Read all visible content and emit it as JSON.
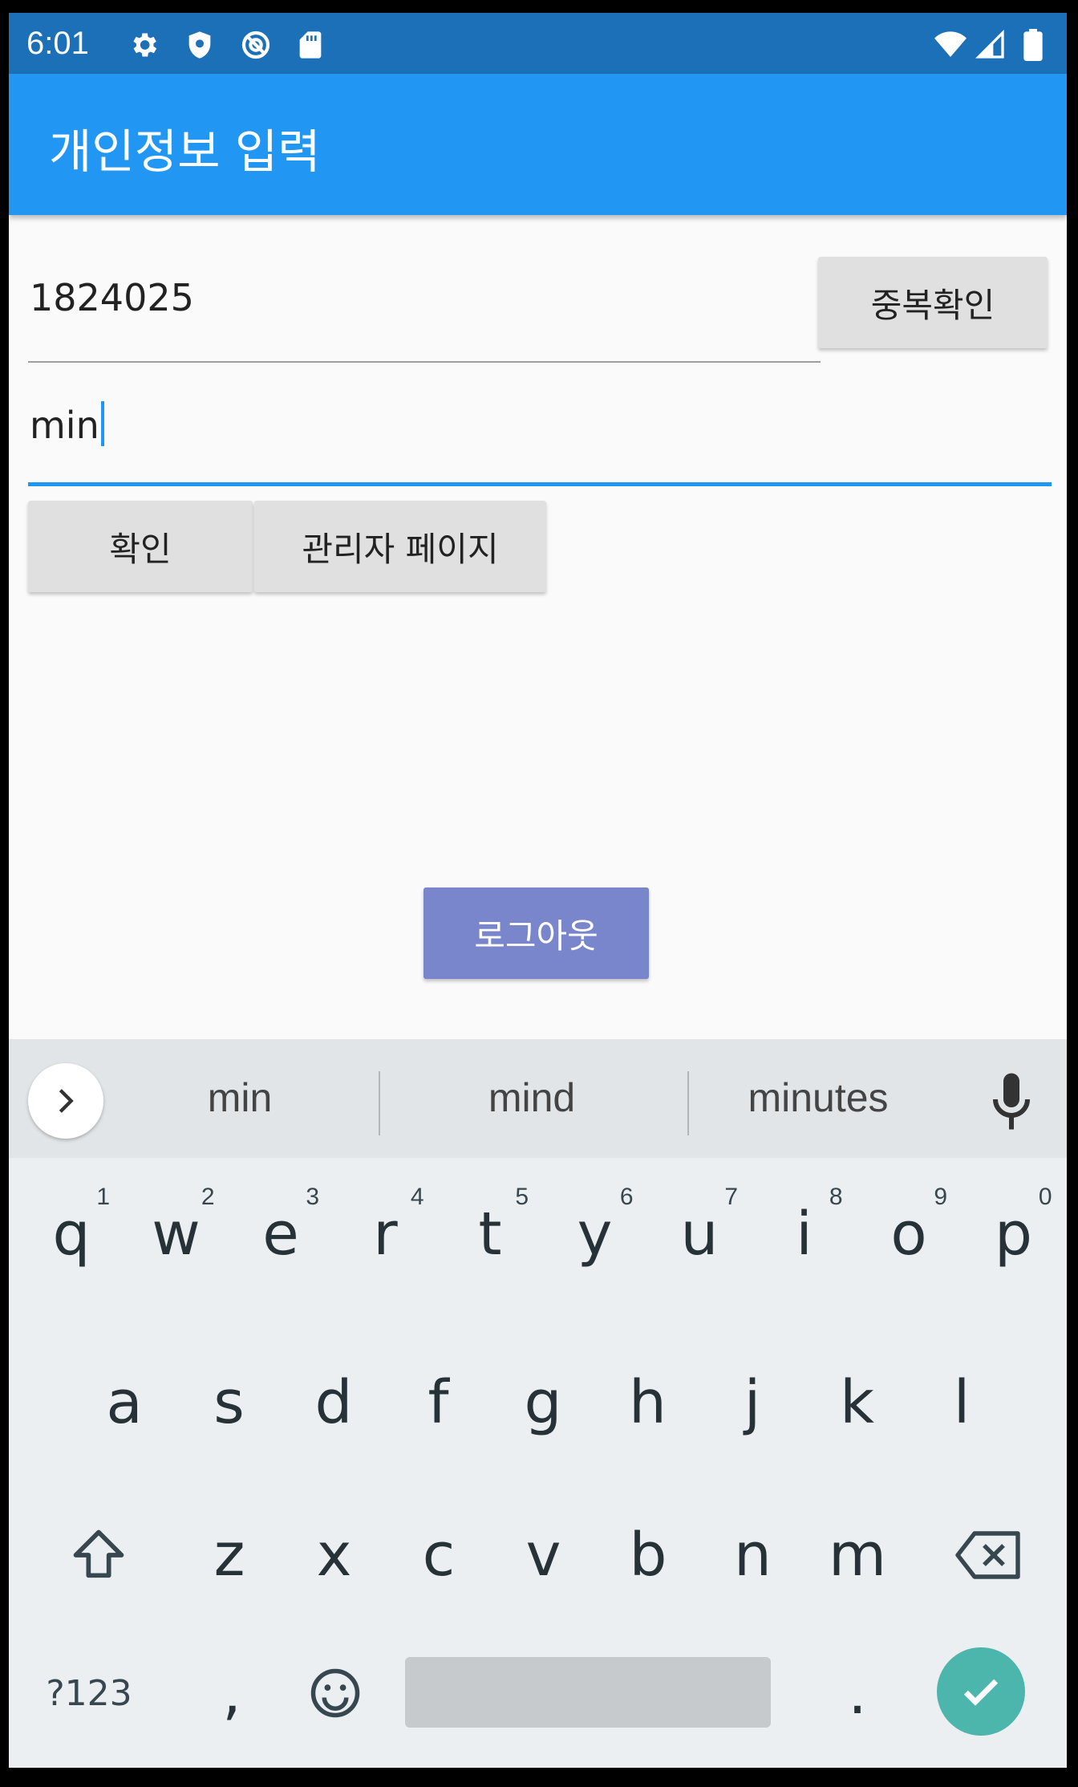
{
  "status_bar": {
    "time": "6:01",
    "icons": [
      "settings-icon",
      "shield-icon",
      "sync-off-icon",
      "sd-card-icon",
      "wifi-icon",
      "signal-icon",
      "battery-icon"
    ]
  },
  "app_bar": {
    "title": "개인정보 입력"
  },
  "form": {
    "id_value": "1824025",
    "dup_check_label": "중복확인",
    "name_value": "min",
    "confirm_label": "확인",
    "admin_label": "관리자 페이지",
    "logout_label": "로그아웃"
  },
  "keyboard": {
    "suggestions": [
      "min",
      "mind",
      "minutes"
    ],
    "row1": [
      "q",
      "w",
      "e",
      "r",
      "t",
      "y",
      "u",
      "i",
      "o",
      "p"
    ],
    "row1_hints": [
      "1",
      "2",
      "3",
      "4",
      "5",
      "6",
      "7",
      "8",
      "9",
      "0"
    ],
    "row2": [
      "a",
      "s",
      "d",
      "f",
      "g",
      "h",
      "j",
      "k",
      "l"
    ],
    "row3": [
      "z",
      "x",
      "c",
      "v",
      "b",
      "n",
      "m"
    ],
    "symbols_label": "?123",
    "comma": ",",
    "period": "."
  },
  "colors": {
    "status_bar": "#1c70b8",
    "app_bar": "#2196f3",
    "primary_button": "#7986cb",
    "enter_key": "#4db6ac"
  }
}
